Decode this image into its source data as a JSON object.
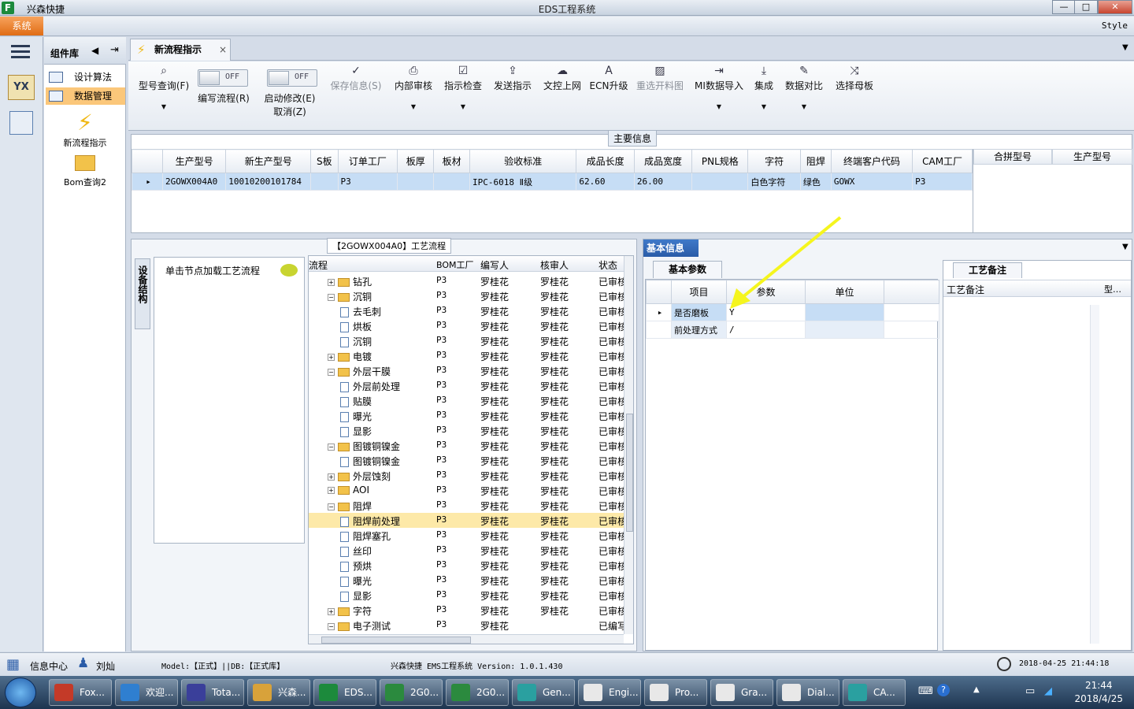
{
  "window": {
    "app_name": "兴森快捷",
    "title": "EDS工程系统",
    "min": "—",
    "max": "□",
    "close": "✕"
  },
  "menu": {
    "system": "系统",
    "style": "Style"
  },
  "complib": {
    "title": "组件库",
    "items": [
      {
        "label": "设计算法"
      },
      {
        "label": "数据管理"
      }
    ],
    "tools": [
      {
        "label": "新流程指示"
      },
      {
        "label": "Bom查询2"
      }
    ]
  },
  "doc_tab": {
    "label": "新流程指示",
    "close": "×"
  },
  "toolbar": {
    "type_query": "型号查询(F)",
    "write_flow": "编写流程(R)",
    "start_modify": "启动修改(E)",
    "cancel": "取消(Z)",
    "toggle_off": "OFF",
    "buttons": [
      {
        "label": "保存信息(S)",
        "icon": "✓"
      },
      {
        "label": "内部审核",
        "icon": "⎙"
      },
      {
        "label": "指示检查",
        "icon": "☑"
      },
      {
        "label": "发送指示",
        "icon": "⇪"
      },
      {
        "label": "文控上网",
        "icon": "☁"
      },
      {
        "label": "ECN升级",
        "icon": "A"
      },
      {
        "label": "重选开料图",
        "icon": "▨"
      },
      {
        "label": "MI数据导入",
        "icon": "⇥"
      },
      {
        "label": "集成",
        "icon": "⤓"
      },
      {
        "label": "数据对比",
        "icon": "✎"
      },
      {
        "label": "选择母板",
        "icon": "⤨"
      }
    ]
  },
  "main_info": {
    "caption": "主要信息",
    "columns": [
      "生产型号",
      "新生产型号",
      "S板",
      "订单工厂",
      "板厚",
      "板材",
      "验收标准",
      "成品长度",
      "成品宽度",
      "PNL规格",
      "字符",
      "阻焊",
      "终端客户代码",
      "CAM工厂"
    ],
    "row": [
      "2GOWX004A0",
      "10010200101784",
      "",
      "P3",
      "",
      "",
      "IPC-6018 Ⅱ级",
      "62.60",
      "26.00",
      "",
      "白色字符",
      "绿色",
      "GOWX",
      "P3"
    ],
    "side_columns": [
      "合拼型号",
      "生产型号"
    ]
  },
  "flow": {
    "caption": "【2GOWX004A0】工艺流程",
    "side_tab": "设备结构",
    "load_hint": "单击节点加载工艺流程",
    "columns": [
      "流程",
      "BOM工厂",
      "编写人",
      "核审人",
      "状态"
    ],
    "rows": [
      {
        "name": "钻孔",
        "level": 0,
        "type": "folder",
        "exp": "+",
        "bom": "P3",
        "writer": "罗桂花",
        "checker": "罗桂花",
        "status": "已审核"
      },
      {
        "name": "沉铜",
        "level": 0,
        "type": "folder",
        "exp": "−",
        "bom": "P3",
        "writer": "罗桂花",
        "checker": "罗桂花",
        "status": "已审核"
      },
      {
        "name": "去毛刺",
        "level": 1,
        "type": "file",
        "bom": "P3",
        "writer": "罗桂花",
        "checker": "罗桂花",
        "status": "已审核"
      },
      {
        "name": "烘板",
        "level": 1,
        "type": "file",
        "bom": "P3",
        "writer": "罗桂花",
        "checker": "罗桂花",
        "status": "已审核"
      },
      {
        "name": "沉铜",
        "level": 1,
        "type": "file",
        "bom": "P3",
        "writer": "罗桂花",
        "checker": "罗桂花",
        "status": "已审核"
      },
      {
        "name": "电镀",
        "level": 0,
        "type": "folder",
        "exp": "+",
        "bom": "P3",
        "writer": "罗桂花",
        "checker": "罗桂花",
        "status": "已审核"
      },
      {
        "name": "外层干膜",
        "level": 0,
        "type": "folder",
        "exp": "−",
        "bom": "P3",
        "writer": "罗桂花",
        "checker": "罗桂花",
        "status": "已审核"
      },
      {
        "name": "外层前处理",
        "level": 1,
        "type": "file",
        "bom": "P3",
        "writer": "罗桂花",
        "checker": "罗桂花",
        "status": "已审核"
      },
      {
        "name": "贴膜",
        "level": 1,
        "type": "file",
        "bom": "P3",
        "writer": "罗桂花",
        "checker": "罗桂花",
        "status": "已审核"
      },
      {
        "name": "曝光",
        "level": 1,
        "type": "file",
        "bom": "P3",
        "writer": "罗桂花",
        "checker": "罗桂花",
        "status": "已审核"
      },
      {
        "name": "显影",
        "level": 1,
        "type": "file",
        "bom": "P3",
        "writer": "罗桂花",
        "checker": "罗桂花",
        "status": "已审核"
      },
      {
        "name": "图镀铜镍金",
        "level": 0,
        "type": "folder",
        "exp": "−",
        "bom": "P3",
        "writer": "罗桂花",
        "checker": "罗桂花",
        "status": "已审核"
      },
      {
        "name": "图镀铜镍金",
        "level": 1,
        "type": "file",
        "bom": "P3",
        "writer": "罗桂花",
        "checker": "罗桂花",
        "status": "已审核"
      },
      {
        "name": "外层蚀刻",
        "level": 0,
        "type": "folder",
        "exp": "+",
        "bom": "P3",
        "writer": "罗桂花",
        "checker": "罗桂花",
        "status": "已审核"
      },
      {
        "name": "AOI",
        "level": 0,
        "type": "folder",
        "exp": "+",
        "bom": "P3",
        "writer": "罗桂花",
        "checker": "罗桂花",
        "status": "已审核"
      },
      {
        "name": "阻焊",
        "level": 0,
        "type": "folder",
        "exp": "−",
        "bom": "P3",
        "writer": "罗桂花",
        "checker": "罗桂花",
        "status": "已审核"
      },
      {
        "name": "阻焊前处理",
        "level": 1,
        "type": "file",
        "selected": true,
        "bom": "P3",
        "writer": "罗桂花",
        "checker": "罗桂花",
        "status": "已审核"
      },
      {
        "name": "阻焊塞孔",
        "level": 1,
        "type": "file",
        "bom": "P3",
        "writer": "罗桂花",
        "checker": "罗桂花",
        "status": "已审核"
      },
      {
        "name": "丝印",
        "level": 1,
        "type": "file",
        "bom": "P3",
        "writer": "罗桂花",
        "checker": "罗桂花",
        "status": "已审核"
      },
      {
        "name": "预烘",
        "level": 1,
        "type": "file",
        "bom": "P3",
        "writer": "罗桂花",
        "checker": "罗桂花",
        "status": "已审核"
      },
      {
        "name": "曝光",
        "level": 1,
        "type": "file",
        "bom": "P3",
        "writer": "罗桂花",
        "checker": "罗桂花",
        "status": "已审核"
      },
      {
        "name": "显影",
        "level": 1,
        "type": "file",
        "bom": "P3",
        "writer": "罗桂花",
        "checker": "罗桂花",
        "status": "已审核"
      },
      {
        "name": "字符",
        "level": 0,
        "type": "folder",
        "exp": "+",
        "bom": "P3",
        "writer": "罗桂花",
        "checker": "罗桂花",
        "status": "已审核"
      },
      {
        "name": "电子测试",
        "level": 0,
        "type": "folder",
        "exp": "−",
        "bom": "P3",
        "writer": "罗桂花",
        "checker": "",
        "status": "已编写"
      }
    ]
  },
  "basic": {
    "title": "基本信息",
    "tab": "基本参数",
    "columns": [
      "项目",
      "参数",
      "单位"
    ],
    "rows": [
      {
        "item": "是否磨板",
        "param": "Y",
        "unit": ""
      },
      {
        "item": "前处理方式",
        "param": "/",
        "unit": ""
      }
    ],
    "note_tab": "工艺备注",
    "note_label": "工艺备注",
    "note_col2": "型…",
    "arrow_color": "#f5f51e"
  },
  "status": {
    "info_center": "信息中心",
    "user": "刘灿",
    "model": "Model:【正式】||DB:【正式库】",
    "version": "兴森快捷 EMS工程系统 Version: 1.0.1.430",
    "datetime": "2018-04-25 21:44:18"
  },
  "taskbar": {
    "tasks": [
      {
        "label": "Fox...",
        "color": "#c43a28"
      },
      {
        "label": "欢迎...",
        "color": "#2f7fd0"
      },
      {
        "label": "Tota...",
        "color": "#3a3f9a"
      },
      {
        "label": "兴森...",
        "color": "#d8a23a"
      },
      {
        "label": "EDS...",
        "color": "#1c8a3c"
      },
      {
        "label": "2G0...",
        "color": "#2b8a3e"
      },
      {
        "label": "2G0...",
        "color": "#2b8a3e"
      },
      {
        "label": "Gen...",
        "color": "#2aa0a0"
      },
      {
        "label": "Engi...",
        "color": "#e8e8e8"
      },
      {
        "label": "Pro...",
        "color": "#e8e8e8"
      },
      {
        "label": "Gra...",
        "color": "#e8e8e8"
      },
      {
        "label": "Dial...",
        "color": "#e8e8e8"
      },
      {
        "label": "CA...",
        "color": "#2aa0a0"
      }
    ],
    "time": "21:44",
    "date": "2018/4/25"
  }
}
